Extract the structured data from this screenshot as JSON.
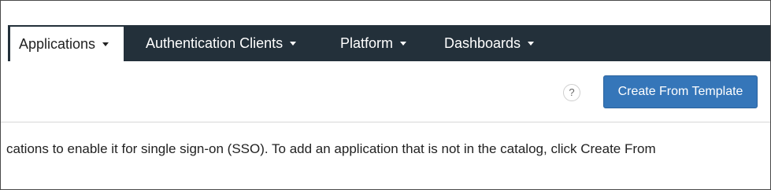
{
  "nav": {
    "items": [
      {
        "label": "Applications",
        "active": true
      },
      {
        "label": "Authentication Clients",
        "active": false
      },
      {
        "label": "Platform",
        "active": false
      },
      {
        "label": "Dashboards",
        "active": false
      }
    ]
  },
  "toolbar": {
    "help_glyph": "?",
    "create_label": "Create From Template"
  },
  "content": {
    "description": "cations to enable it for single sign-on (SSO). To add an application that is not in the catalog, click Create From"
  },
  "colors": {
    "navbar_bg": "#23303a",
    "primary_button": "#3576b9"
  },
  "icons": [
    "help-icon",
    "caret-down-icon"
  ]
}
